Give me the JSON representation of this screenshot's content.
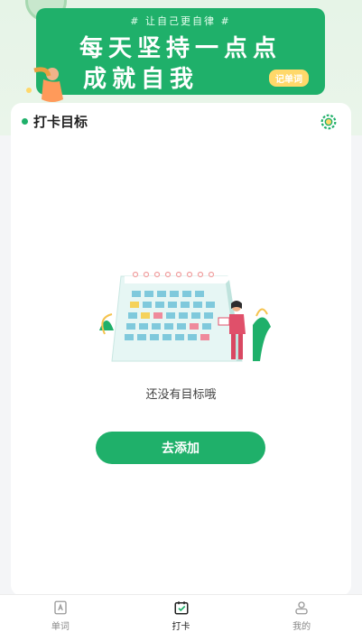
{
  "banner": {
    "tagline": "# 让自己更自律 #",
    "line1": "每天坚持一点点",
    "line2": "成就自我",
    "chip": "记单词"
  },
  "card": {
    "title": "打卡目标",
    "empty_text": "还没有目标哦",
    "add_button": "去添加"
  },
  "nav": {
    "items": [
      {
        "label": "单词",
        "icon": "word-book-icon",
        "active": false
      },
      {
        "label": "打卡",
        "icon": "checkin-calendar-icon",
        "active": true
      },
      {
        "label": "我的",
        "icon": "profile-icon",
        "active": false
      }
    ]
  },
  "colors": {
    "accent": "#1fb06a",
    "chip": "#ffd86a"
  }
}
